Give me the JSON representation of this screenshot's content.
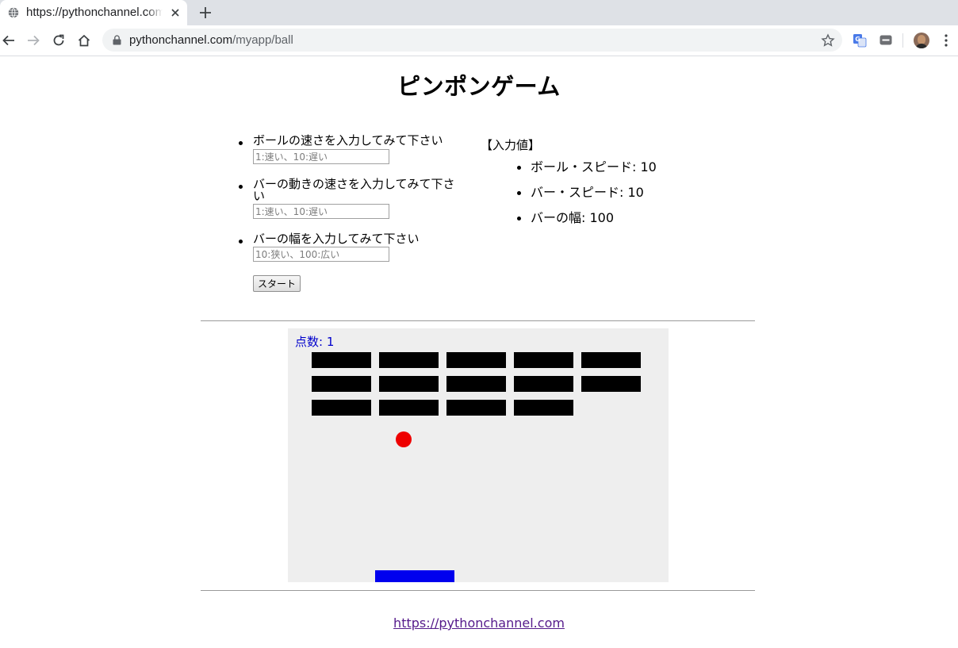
{
  "browser": {
    "tab_title": "https://pythonchannel.com/myapp/ball",
    "url_host": "pythonchannel.com",
    "url_path": "/myapp/ball"
  },
  "page": {
    "title": "ピンポンゲーム",
    "form": {
      "ball_speed_label": "ボールの速さを入力してみて下さい",
      "ball_speed_placeholder": "1:速い、10:遅い",
      "ball_speed_value": "",
      "bar_speed_label": "バーの動きの速さを入力してみて下さい",
      "bar_speed_placeholder": "1:速い、10:遅い",
      "bar_speed_value": "",
      "bar_width_label": "バーの幅を入力してみて下さい",
      "bar_width_placeholder": "10:狭い、100:広い",
      "bar_width_value": "",
      "start_label": "スタート"
    },
    "input_values": {
      "heading": "【入力値】",
      "items": [
        "ボール・スピード: 10",
        "バー・スピード: 10",
        "バーの幅: 100"
      ]
    },
    "game": {
      "score_text": "点数: 1",
      "brick_rows": [
        5,
        5,
        4
      ],
      "colors": {
        "background": "#eeeeee",
        "brick": "#000000",
        "ball": "#ee0000",
        "paddle": "#0000ee",
        "score": "#0000cc"
      }
    },
    "footer_link": "https://pythonchannel.com"
  }
}
